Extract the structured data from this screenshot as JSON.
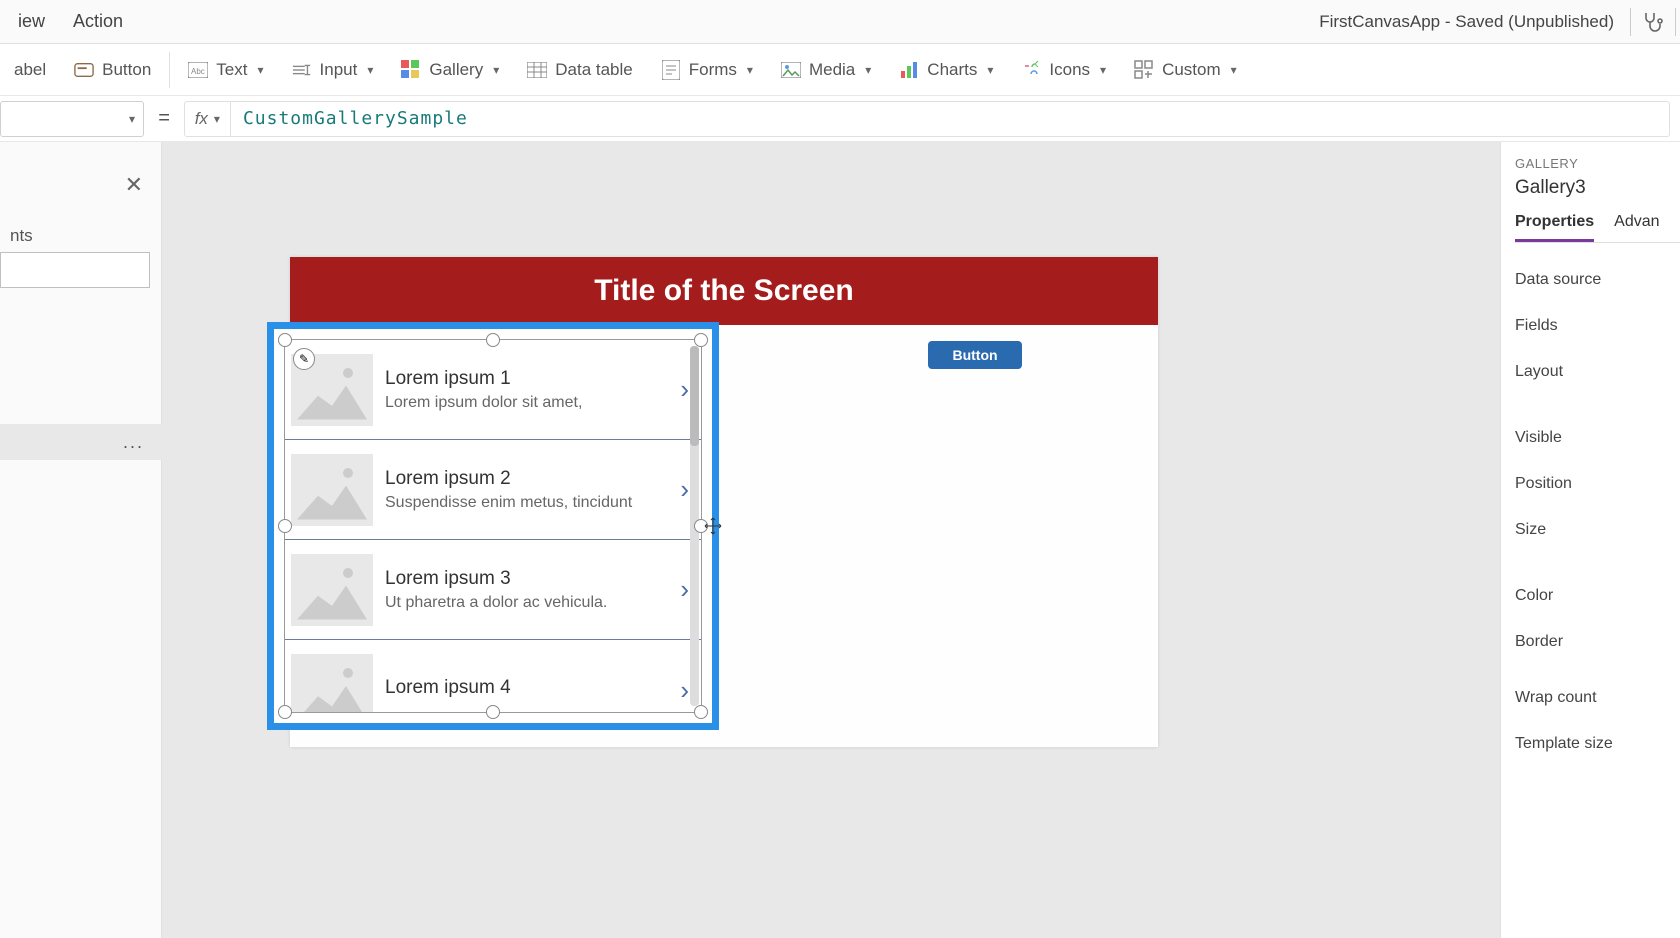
{
  "menubar": {
    "items": [
      "iew",
      "Action"
    ],
    "appTitle": "FirstCanvasApp - Saved (Unpublished)"
  },
  "ribbon": {
    "items": [
      {
        "label": "abel"
      },
      {
        "label": "Button"
      },
      {
        "label": "Text",
        "dd": true
      },
      {
        "label": "Input",
        "dd": true
      },
      {
        "label": "Gallery",
        "dd": true
      },
      {
        "label": "Data table"
      },
      {
        "label": "Forms",
        "dd": true
      },
      {
        "label": "Media",
        "dd": true
      },
      {
        "label": "Charts",
        "dd": true
      },
      {
        "label": "Icons",
        "dd": true
      },
      {
        "label": "Custom",
        "dd": true
      }
    ]
  },
  "formula": {
    "value": "CustomGallerySample"
  },
  "leftPanel": {
    "tabLabel": "nts",
    "selectedDots": "..."
  },
  "screen": {
    "title": "Title of the Screen",
    "buttonLabel": "Button"
  },
  "gallery": {
    "items": [
      {
        "title": "Lorem ipsum 1",
        "sub": "Lorem ipsum dolor sit amet,"
      },
      {
        "title": "Lorem ipsum 2",
        "sub": "Suspendisse enim metus, tincidunt"
      },
      {
        "title": "Lorem ipsum 3",
        "sub": "Ut pharetra a dolor ac vehicula."
      },
      {
        "title": "Lorem ipsum 4",
        "sub": ""
      }
    ]
  },
  "propPanel": {
    "category": "GALLERY",
    "name": "Gallery3",
    "tabs": [
      "Properties",
      "Advan"
    ],
    "rows": [
      "Data source",
      "Fields",
      "Layout",
      "Visible",
      "Position",
      "Size",
      "Color",
      "Border",
      "Wrap count",
      "Template size"
    ]
  }
}
